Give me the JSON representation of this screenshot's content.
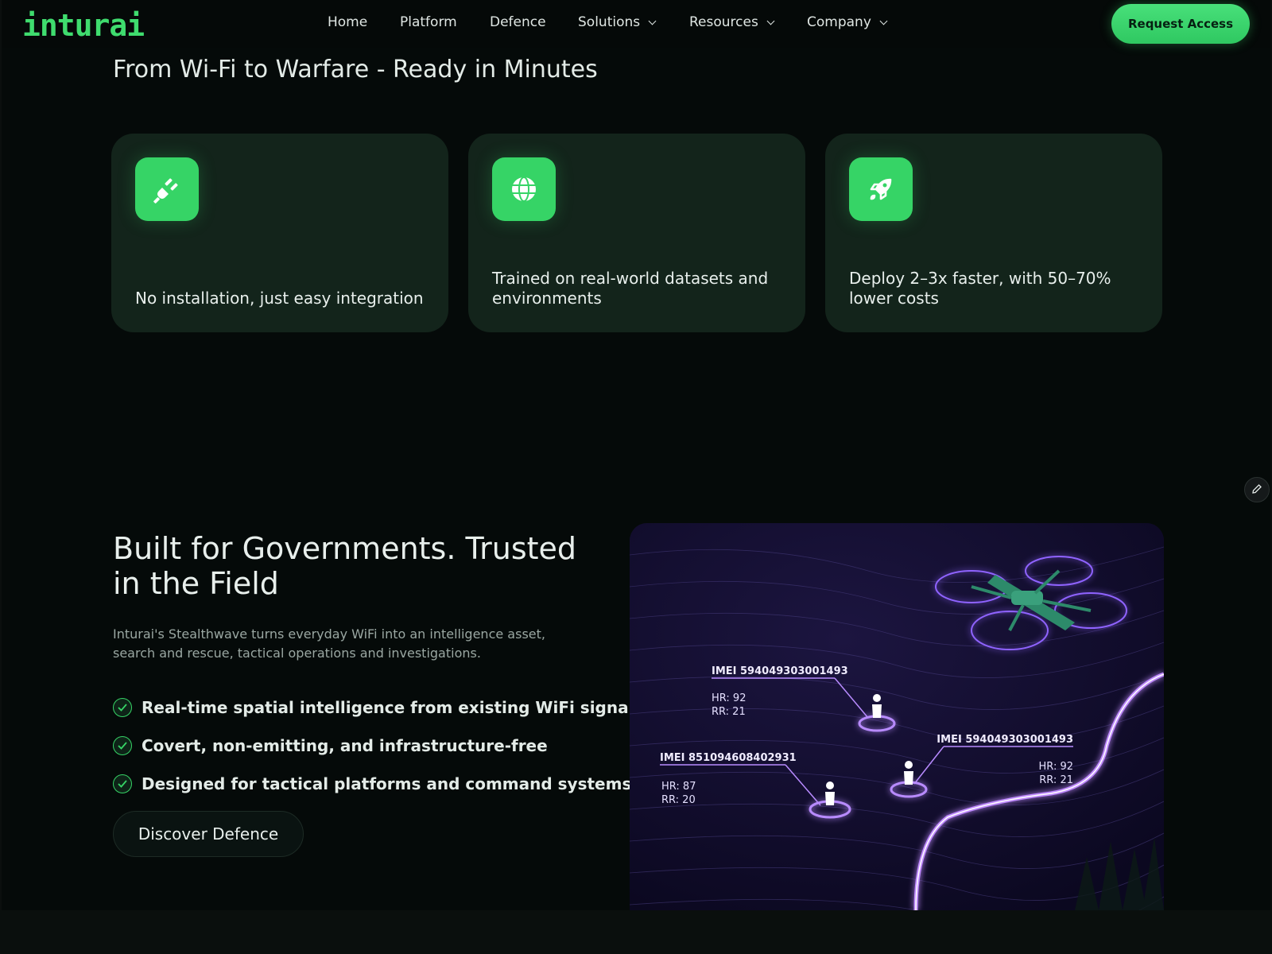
{
  "nav": {
    "logo": "inturai",
    "links": [
      {
        "label": "Home",
        "dropdown": false
      },
      {
        "label": "Platform",
        "dropdown": false
      },
      {
        "label": "Defence",
        "dropdown": false
      },
      {
        "label": "Solutions",
        "dropdown": true
      },
      {
        "label": "Resources",
        "dropdown": true
      },
      {
        "label": "Company",
        "dropdown": true
      }
    ],
    "cta": "Request Access"
  },
  "ready": {
    "title": "From Wi-Fi to Warfare - Ready in Minutes",
    "cards": [
      {
        "icon": "plug-icon",
        "text": "No installation, just easy integration"
      },
      {
        "icon": "globe-icon",
        "text": "Trained on real-world datasets and environments"
      },
      {
        "icon": "rocket-icon",
        "text": "Deploy 2–3x faster, with 50–70% lower costs"
      }
    ]
  },
  "government": {
    "title": "Built for Governments. Trusted in the Field",
    "description": "Inturai's Stealthwave turns everyday WiFi into an intelligence asset, search and rescue, tactical operations and investigations.",
    "features": [
      "Real-time spatial intelligence from existing WiFi signals",
      "Covert, non-emitting, and infrastructure-free",
      "Designed for tactical platforms and command systems"
    ],
    "cta": "Discover Defence"
  },
  "map": {
    "targets": [
      {
        "imei": "IMEI 594049303001493",
        "hr": "HR: 92",
        "rr": "RR: 21"
      },
      {
        "imei": "IMEI 851094608402931",
        "hr": "HR: 87",
        "rr": "RR: 20"
      },
      {
        "imei": "IMEI 594049303001493",
        "hr": "HR: 92",
        "rr": "RR: 21"
      }
    ]
  },
  "colors": {
    "accent": "#36d466",
    "background": "#050a09",
    "card": "#13241b",
    "map_glow": "#a46bff"
  }
}
